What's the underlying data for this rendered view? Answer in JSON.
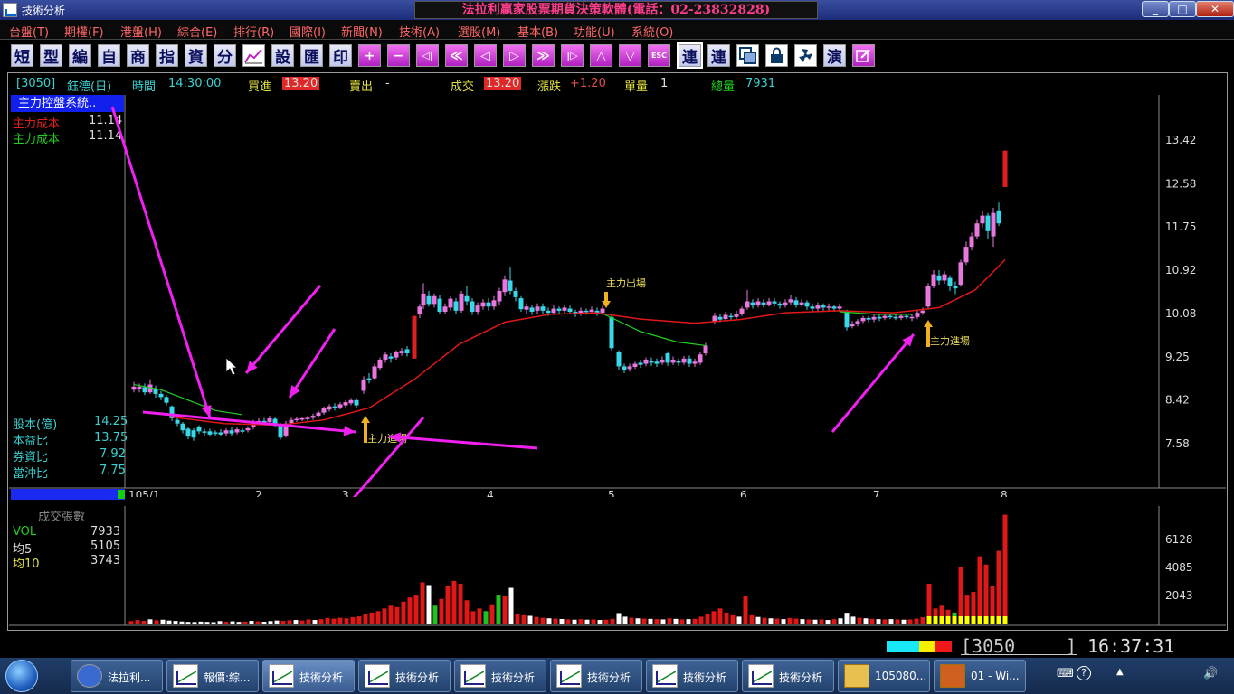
{
  "window": {
    "title": "技術分析",
    "banner": "法拉利贏家股票期貨決策軟體(電話：02-23832828)",
    "controls": [
      "_",
      "□",
      "✕"
    ]
  },
  "menu": [
    "台盤(T)",
    "期權(F)",
    "港盤(H)",
    "綜合(E)",
    "排行(R)",
    "國際(I)",
    "新聞(N)",
    "技術(A)",
    "選股(M)",
    "基本(B)",
    "功能(U)",
    "系統(O)"
  ],
  "toolbar": {
    "text_buttons": [
      "短",
      "型",
      "編",
      "自",
      "商",
      "指",
      "資",
      "分"
    ],
    "text_buttons2": [
      "設",
      "匯",
      "印"
    ],
    "glyph_buttons": [
      "+",
      "−",
      "◁|",
      "≪",
      "◁",
      "▷",
      "≫",
      "|▷",
      "△",
      "▽",
      "ESC"
    ],
    "text_buttons3": [
      "連",
      "連"
    ],
    "text_buttons4": [
      "演"
    ]
  },
  "quote": {
    "code": "[3050]",
    "name": "鈺德(日)",
    "time_label": "時間",
    "time": "14:30:00",
    "bid_label": "買進",
    "bid": "13.20",
    "ask_label": "賣出",
    "ask": "-",
    "last_label": "成交",
    "last": "13.20",
    "change_label": "漲跌",
    "change": "+1.20",
    "unit_label": "單量",
    "unit": "1",
    "total_label": "總量",
    "total": "7931"
  },
  "study": {
    "header": "主力控盤系統..",
    "line1_label": "主力成本",
    "line1_value": "11.14",
    "line2_label": "主力成本",
    "line2_value": "11.14"
  },
  "fundamentals": [
    {
      "label": "股本(億)",
      "value": "14.25"
    },
    {
      "label": "本益比",
      "value": "13.75"
    },
    {
      "label": "券資比",
      "value": "7.92"
    },
    {
      "label": "當沖比",
      "value": "7.75"
    }
  ],
  "annotations": {
    "exit": "主力出場",
    "enter1": "主力進場",
    "enter2": "主力進場"
  },
  "volume_panel": {
    "header": "成交張數",
    "vol_label": "VOL",
    "vol_value": "7933",
    "ma5_label": "均5",
    "ma5_value": "5105",
    "ma10_label": "均10",
    "ma10_value": "3743"
  },
  "status": {
    "code": "[3050",
    "bracket": "]",
    "clock": "16:37:31"
  },
  "taskbar": {
    "items": [
      "法拉利...",
      "報價:綜...",
      "技術分析",
      "技術分析",
      "技術分析",
      "技術分析",
      "技術分析",
      "技術分析",
      "105080...",
      "01 - Wi..."
    ],
    "tray": [
      "⌨",
      "?",
      "▲",
      "🔊"
    ]
  },
  "chart_data": [
    {
      "type": "candlestick",
      "x_tick_labels": [
        "105/1",
        "2",
        "3",
        "4",
        "5",
        "6",
        "7",
        "8"
      ],
      "y_tick_labels": [
        "13.42",
        "12.58",
        "11.75",
        "10.92",
        "10.08",
        "9.25",
        "8.42",
        "7.58"
      ],
      "ylim": [
        7.0,
        13.9
      ],
      "series_colors": {
        "up": "#e878e0",
        "down": "#38d8e8",
        "limit_up": "#e02020"
      },
      "cost_line_color": "#e01818",
      "ma_line_color": "#20d020"
    },
    {
      "type": "bar",
      "y_tick_labels": [
        "6128",
        "4085",
        "2043"
      ],
      "ylim": [
        0,
        8300
      ],
      "colors": {
        "up": "#e01818",
        "down": "#20c020",
        "flat": "#ffffff",
        "ma": "#ffff00"
      }
    }
  ]
}
